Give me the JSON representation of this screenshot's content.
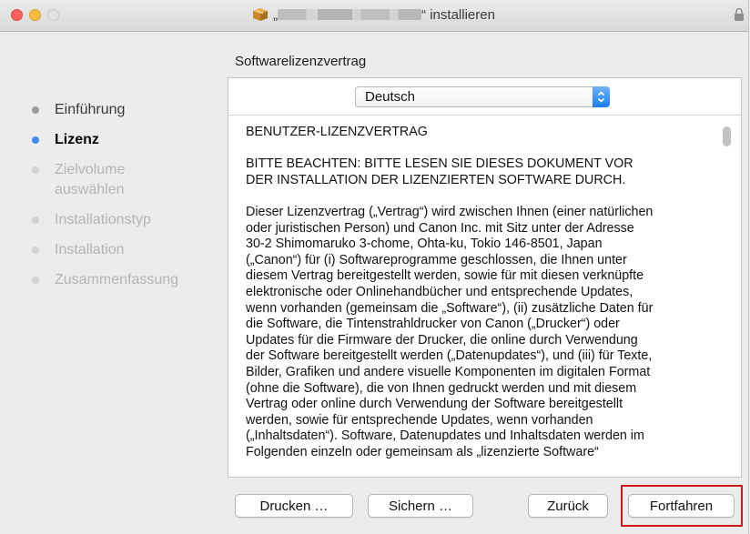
{
  "window": {
    "title_prefix": "„",
    "title_suffix": "“ installieren"
  },
  "sidebar": {
    "steps": [
      {
        "label": "Einführung",
        "state": "done"
      },
      {
        "label": "Lizenz",
        "state": "active"
      },
      {
        "label": "Zielvolume auswählen",
        "state": "pending"
      },
      {
        "label": "Installationstyp",
        "state": "pending"
      },
      {
        "label": "Installation",
        "state": "pending"
      },
      {
        "label": "Zusammenfassung",
        "state": "pending"
      }
    ]
  },
  "main": {
    "section_title": "Softwarelizenzvertrag",
    "language_select": {
      "selected": "Deutsch"
    },
    "license_text": "BENUTZER-LIZENZVERTRAG\n\nBITTE BEACHTEN: BITTE LESEN SIE DIESES DOKUMENT VOR\nDER INSTALLATION DER LIZENZIERTEN SOFTWARE DURCH.\n\nDieser Lizenzvertrag („Vertrag“) wird zwischen Ihnen (einer natürlichen\noder juristischen Person) und Canon Inc. mit Sitz unter der Adresse\n30-2 Shimomaruko 3-chome, Ohta-ku, Tokio 146-8501, Japan\n(„Canon“) für (i) Softwareprogramme geschlossen, die Ihnen unter\ndiesem Vertrag bereitgestellt werden, sowie für mit diesen verknüpfte\nelektronische oder Onlinehandbücher und entsprechende Updates,\nwenn vorhanden (gemeinsam die „Software“), (ii) zusätzliche Daten für\ndie Software, die Tintenstrahldrucker von Canon („Drucker“) oder\nUpdates für die Firmware der Drucker, die online durch Verwendung\nder Software bereitgestellt werden („Datenupdates“), und (iii) für Texte,\nBilder, Grafiken und andere visuelle Komponenten im digitalen Format\n(ohne die Software), die von Ihnen gedruckt werden und mit diesem\nVertrag oder online durch Verwendung der Software bereitgestellt\nwerden, sowie für entsprechende Updates, wenn vorhanden\n(„Inhaltsdaten“).  Software, Datenupdates und Inhaltsdaten werden im\nFolgenden einzeln oder gemeinsam als „lizenzierte Software“"
  },
  "buttons": {
    "print": "Drucken …",
    "save": "Sichern …",
    "back": "Zurück",
    "continue": "Fortfahren"
  },
  "colors": {
    "active_step_dot": "#3d8ef0",
    "highlight_border": "#d0151a",
    "close": "#fc605c",
    "minimize": "#fdbc40"
  },
  "icons": {
    "title_icon": "package-icon",
    "lock": "lock-icon",
    "select_arrows": "up-down-chevron-icon"
  }
}
